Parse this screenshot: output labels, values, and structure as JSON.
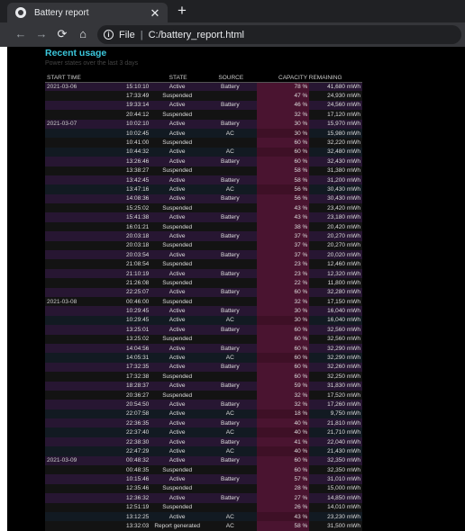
{
  "tab": {
    "title": "Battery report",
    "close_glyph": "✕",
    "new_tab_glyph": "+"
  },
  "toolbar": {
    "back_glyph": "←",
    "forward_glyph": "→",
    "reload_glyph": "⟳",
    "home_glyph": "⌂",
    "info_glyph": "i",
    "scheme": "File",
    "separator": "|",
    "url": "C:/battery_report.html"
  },
  "report": {
    "title": "Recent usage",
    "subtitle": "Power states over the last 3 days",
    "headers": {
      "start_time": "START TIME",
      "state": "STATE",
      "source": "SOURCE",
      "capacity": "CAPACITY REMAINING"
    },
    "rows": [
      {
        "date": "2021-03-06",
        "time": "15:10:10",
        "state": "Active",
        "source": "Battery",
        "pct": "78 %",
        "cap": "41,680 mWh"
      },
      {
        "date": "",
        "time": "17:33:49",
        "state": "Suspended",
        "source": "",
        "pct": "47 %",
        "cap": "24,930 mWh"
      },
      {
        "date": "",
        "time": "19:33:14",
        "state": "Active",
        "source": "Battery",
        "pct": "46 %",
        "cap": "24,560 mWh"
      },
      {
        "date": "",
        "time": "20:44:12",
        "state": "Suspended",
        "source": "",
        "pct": "32 %",
        "cap": "17,120 mWh"
      },
      {
        "date": "2021-03-07",
        "time": "10:02:10",
        "state": "Active",
        "source": "Battery",
        "pct": "30 %",
        "cap": "15,970 mWh"
      },
      {
        "date": "",
        "time": "10:02:45",
        "state": "Active",
        "source": "AC",
        "pct": "30 %",
        "cap": "15,980 mWh"
      },
      {
        "date": "",
        "time": "10:41:00",
        "state": "Suspended",
        "source": "",
        "pct": "60 %",
        "cap": "32,220 mWh"
      },
      {
        "date": "",
        "time": "10:44:32",
        "state": "Active",
        "source": "AC",
        "pct": "60 %",
        "cap": "32,480 mWh"
      },
      {
        "date": "",
        "time": "13:26:46",
        "state": "Active",
        "source": "Battery",
        "pct": "60 %",
        "cap": "32,430 mWh"
      },
      {
        "date": "",
        "time": "13:38:27",
        "state": "Suspended",
        "source": "",
        "pct": "58 %",
        "cap": "31,380 mWh"
      },
      {
        "date": "",
        "time": "13:42:45",
        "state": "Active",
        "source": "Battery",
        "pct": "58 %",
        "cap": "31,200 mWh"
      },
      {
        "date": "",
        "time": "13:47:16",
        "state": "Active",
        "source": "AC",
        "pct": "56 %",
        "cap": "30,430 mWh"
      },
      {
        "date": "",
        "time": "14:08:36",
        "state": "Active",
        "source": "Battery",
        "pct": "56 %",
        "cap": "30,430 mWh"
      },
      {
        "date": "",
        "time": "15:25:02",
        "state": "Suspended",
        "source": "",
        "pct": "43 %",
        "cap": "23,420 mWh"
      },
      {
        "date": "",
        "time": "15:41:38",
        "state": "Active",
        "source": "Battery",
        "pct": "43 %",
        "cap": "23,180 mWh"
      },
      {
        "date": "",
        "time": "16:01:21",
        "state": "Suspended",
        "source": "",
        "pct": "38 %",
        "cap": "20,420 mWh"
      },
      {
        "date": "",
        "time": "20:03:18",
        "state": "Active",
        "source": "Battery",
        "pct": "37 %",
        "cap": "20,270 mWh"
      },
      {
        "date": "",
        "time": "20:03:18",
        "state": "Suspended",
        "source": "",
        "pct": "37 %",
        "cap": "20,270 mWh"
      },
      {
        "date": "",
        "time": "20:03:54",
        "state": "Active",
        "source": "Battery",
        "pct": "37 %",
        "cap": "20,020 mWh"
      },
      {
        "date": "",
        "time": "21:08:54",
        "state": "Suspended",
        "source": "",
        "pct": "23 %",
        "cap": "12,460 mWh"
      },
      {
        "date": "",
        "time": "21:10:19",
        "state": "Active",
        "source": "Battery",
        "pct": "23 %",
        "cap": "12,320 mWh"
      },
      {
        "date": "",
        "time": "21:26:08",
        "state": "Suspended",
        "source": "",
        "pct": "22 %",
        "cap": "11,800 mWh"
      },
      {
        "date": "",
        "time": "22:25:07",
        "state": "Active",
        "source": "Battery",
        "pct": "60 %",
        "cap": "32,280 mWh"
      },
      {
        "date": "2021-03-08",
        "time": "00:46:00",
        "state": "Suspended",
        "source": "",
        "pct": "32 %",
        "cap": "17,150 mWh"
      },
      {
        "date": "",
        "time": "10:29:45",
        "state": "Active",
        "source": "Battery",
        "pct": "30 %",
        "cap": "16,040 mWh"
      },
      {
        "date": "",
        "time": "10:29:45",
        "state": "Active",
        "source": "AC",
        "pct": "30 %",
        "cap": "16,040 mWh"
      },
      {
        "date": "",
        "time": "13:25:01",
        "state": "Active",
        "source": "Battery",
        "pct": "60 %",
        "cap": "32,560 mWh"
      },
      {
        "date": "",
        "time": "13:25:02",
        "state": "Suspended",
        "source": "",
        "pct": "60 %",
        "cap": "32,560 mWh"
      },
      {
        "date": "",
        "time": "14:04:56",
        "state": "Active",
        "source": "Battery",
        "pct": "60 %",
        "cap": "32,290 mWh"
      },
      {
        "date": "",
        "time": "14:05:31",
        "state": "Active",
        "source": "AC",
        "pct": "60 %",
        "cap": "32,290 mWh"
      },
      {
        "date": "",
        "time": "17:32:35",
        "state": "Active",
        "source": "Battery",
        "pct": "60 %",
        "cap": "32,260 mWh"
      },
      {
        "date": "",
        "time": "17:32:38",
        "state": "Suspended",
        "source": "",
        "pct": "60 %",
        "cap": "32,250 mWh"
      },
      {
        "date": "",
        "time": "18:28:37",
        "state": "Active",
        "source": "Battery",
        "pct": "59 %",
        "cap": "31,830 mWh"
      },
      {
        "date": "",
        "time": "20:36:27",
        "state": "Suspended",
        "source": "",
        "pct": "32 %",
        "cap": "17,520 mWh"
      },
      {
        "date": "",
        "time": "20:54:50",
        "state": "Active",
        "source": "Battery",
        "pct": "32 %",
        "cap": "17,260 mWh"
      },
      {
        "date": "",
        "time": "22:07:58",
        "state": "Active",
        "source": "AC",
        "pct": "18 %",
        "cap": "9,750 mWh"
      },
      {
        "date": "",
        "time": "22:36:35",
        "state": "Active",
        "source": "Battery",
        "pct": "40 %",
        "cap": "21,810 mWh"
      },
      {
        "date": "",
        "time": "22:37:40",
        "state": "Active",
        "source": "AC",
        "pct": "40 %",
        "cap": "21,710 mWh"
      },
      {
        "date": "",
        "time": "22:38:30",
        "state": "Active",
        "source": "Battery",
        "pct": "41 %",
        "cap": "22,040 mWh"
      },
      {
        "date": "",
        "time": "22:47:29",
        "state": "Active",
        "source": "AC",
        "pct": "40 %",
        "cap": "21,430 mWh"
      },
      {
        "date": "2021-03-09",
        "time": "00:48:32",
        "state": "Active",
        "source": "Battery",
        "pct": "60 %",
        "cap": "32,350 mWh"
      },
      {
        "date": "",
        "time": "00:48:35",
        "state": "Suspended",
        "source": "",
        "pct": "60 %",
        "cap": "32,350 mWh"
      },
      {
        "date": "",
        "time": "10:15:46",
        "state": "Active",
        "source": "Battery",
        "pct": "57 %",
        "cap": "31,010 mWh"
      },
      {
        "date": "",
        "time": "12:35:46",
        "state": "Suspended",
        "source": "",
        "pct": "28 %",
        "cap": "15,000 mWh"
      },
      {
        "date": "",
        "time": "12:36:32",
        "state": "Active",
        "source": "Battery",
        "pct": "27 %",
        "cap": "14,850 mWh"
      },
      {
        "date": "",
        "time": "12:51:19",
        "state": "Suspended",
        "source": "",
        "pct": "26 %",
        "cap": "14,010 mWh"
      },
      {
        "date": "",
        "time": "13:12:25",
        "state": "Active",
        "source": "AC",
        "pct": "43 %",
        "cap": "23,230 mWh"
      },
      {
        "date": "",
        "time": "13:32:03",
        "state": "Report generated",
        "source": "AC",
        "pct": "58 %",
        "cap": "31,500 mWh"
      }
    ]
  }
}
